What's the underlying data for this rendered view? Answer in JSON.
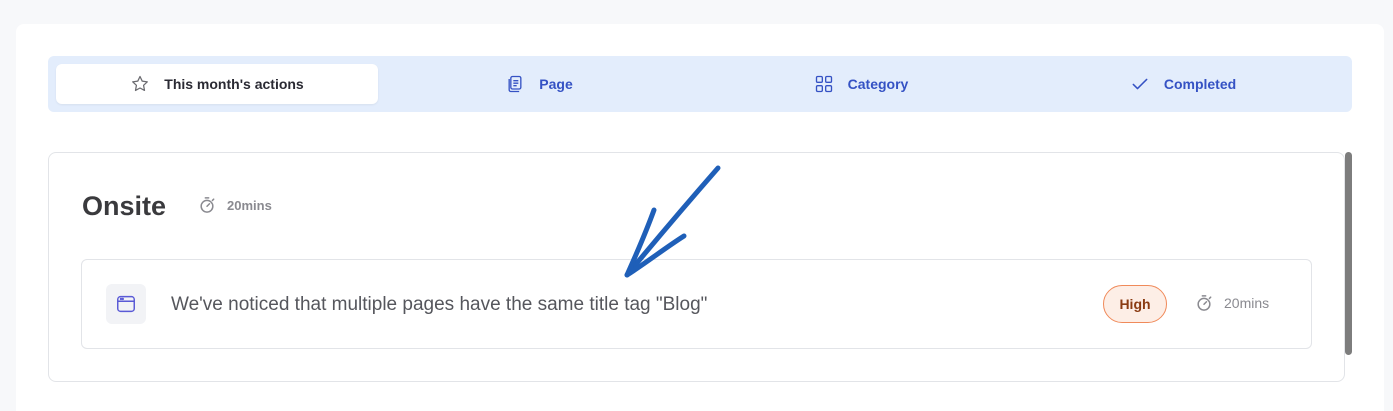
{
  "tabs": [
    {
      "label": "This month's actions",
      "icon": "star-icon",
      "active": true
    },
    {
      "label": "Page",
      "icon": "pages-icon",
      "active": false
    },
    {
      "label": "Category",
      "icon": "grid-icon",
      "active": false
    },
    {
      "label": "Completed",
      "icon": "check-icon",
      "active": false
    }
  ],
  "section": {
    "title": "Onsite",
    "time": "20mins"
  },
  "item": {
    "icon": "browser-window-icon",
    "text": "We've noticed that multiple pages have the same title tag \"Blog\"",
    "priority": "High",
    "time": "20mins"
  },
  "colors": {
    "tab_bar_bg": "#e3edfc",
    "tab_text": "#3552c4",
    "badge_border": "#f08a5a",
    "badge_bg": "#fdeee6",
    "annotation_arrow": "#1f5fb8"
  }
}
